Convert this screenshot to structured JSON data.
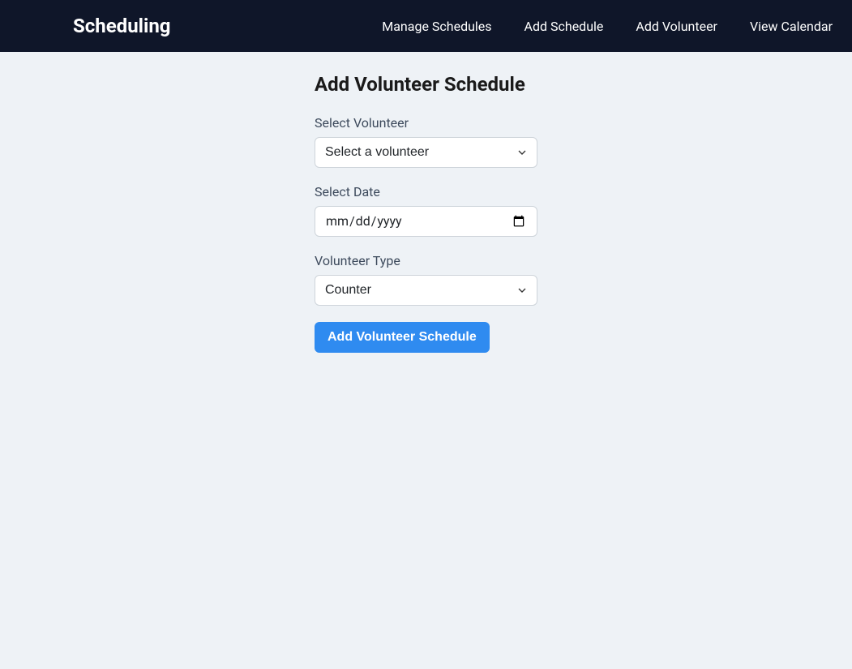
{
  "navbar": {
    "brand": "Scheduling",
    "links": [
      {
        "label": "Manage Schedules"
      },
      {
        "label": "Add Schedule"
      },
      {
        "label": "Add Volunteer"
      },
      {
        "label": "View Calendar"
      }
    ]
  },
  "page": {
    "title": "Add Volunteer Schedule"
  },
  "form": {
    "volunteer_label": "Select Volunteer",
    "volunteer_selected": "Select a volunteer",
    "date_label": "Select Date",
    "date_placeholder": "mm/dd/yyyy",
    "type_label": "Volunteer Type",
    "type_selected": "Counter",
    "submit_label": "Add Volunteer Schedule"
  }
}
